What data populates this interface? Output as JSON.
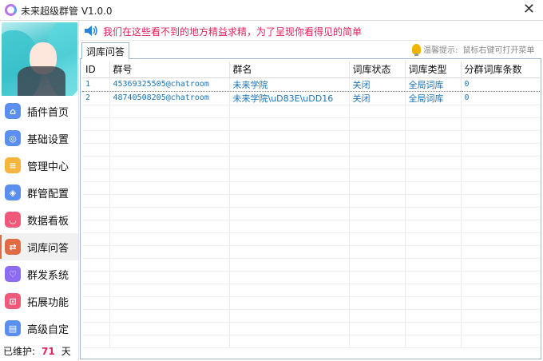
{
  "window": {
    "title": "未来超级群管 V1.0.0",
    "close": "✕"
  },
  "sidebar": {
    "items": [
      {
        "label": "插件首页",
        "icon": "home-icon",
        "color": "#5a8ff0",
        "glyph": "⌂"
      },
      {
        "label": "基础设置",
        "icon": "settings-icon",
        "color": "#5a8ff0",
        "glyph": "◎"
      },
      {
        "label": "管理中心",
        "icon": "notes-icon",
        "color": "#f4b63c",
        "glyph": "≡"
      },
      {
        "label": "群管配置",
        "icon": "layers-icon",
        "color": "#5a8ff0",
        "glyph": "◈"
      },
      {
        "label": "数据看板",
        "icon": "bag-icon",
        "color": "#ef5a7a",
        "glyph": "◡"
      },
      {
        "label": "词库问答",
        "icon": "chat-icon",
        "color": "#e06a43",
        "glyph": "⇄"
      },
      {
        "label": "群发系统",
        "icon": "heart-icon",
        "color": "#8c6cf0",
        "glyph": "♡"
      },
      {
        "label": "拓展功能",
        "icon": "cart-icon",
        "color": "#ef5a7a",
        "glyph": "⊡"
      },
      {
        "label": "高级自定",
        "icon": "folder-icon",
        "color": "#5a8ff0",
        "glyph": "▤"
      }
    ],
    "active_index": 5,
    "maintained": {
      "prefix": "已维护:",
      "days": "71",
      "suffix": "天"
    }
  },
  "notice": {
    "text": "我们在这些看不到的地方精益求精，为了呈现你看得见的简单"
  },
  "tab": {
    "label": "词库问答"
  },
  "hint": {
    "label": "温馨提示:",
    "text": "鼠标右键可打开菜单"
  },
  "table": {
    "columns": [
      "ID",
      "群号",
      "群名",
      "词库状态",
      "词库类型",
      "分群词库条数"
    ],
    "rows": [
      {
        "id": "1",
        "group_id": "45369325505@chatroom",
        "group_name": "未来学院",
        "status": "关闭",
        "type": "全局词库",
        "count": "0"
      },
      {
        "id": "2",
        "group_id": "48740508205@chatroom",
        "group_name": "未来学院\\uD83E\\uDD16",
        "status": "关闭",
        "type": "全局词库",
        "count": "0"
      }
    ]
  }
}
